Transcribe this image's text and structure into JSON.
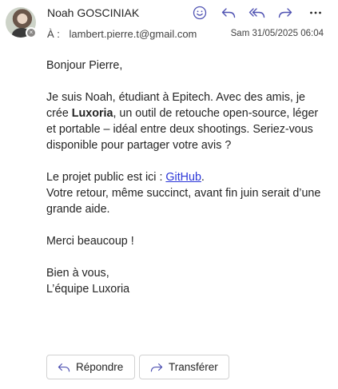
{
  "message": {
    "sender_name": "Noah GOSCINIAK",
    "to_label": "À :",
    "to_address": "lambert.pierre.t@gmail.com",
    "date": "Sam 31/05/2025 06:04",
    "presence_glyph": "×"
  },
  "toolbar": {
    "icons": [
      "emoji-icon",
      "reply-icon",
      "reply-all-icon",
      "forward-icon",
      "more-icon"
    ],
    "accent_color": "#4f52b2"
  },
  "body": {
    "greeting": "Bonjour Pierre,",
    "p1_start": "Je suis Noah, étudiant à Epitech. Avec des amis, je crée ",
    "p1_bold": "Luxoria",
    "p1_end": ", un outil de retouche open-source, léger et portable – idéal entre deux shootings. Seriez-vous disponible pour partager votre avis ?",
    "p2_start": "Le projet public est ici : ",
    "p2_link": "GitHub",
    "p2_end": ".",
    "p2_line2": "Votre retour, même succinct, avant fin juin serait d’une grande aide.",
    "thanks": "Merci beaucoup !",
    "closing": "Bien à vous,",
    "signature": "L’équipe Luxoria",
    "link_color": "#2b36d8"
  },
  "actions": {
    "reply_label": "Répondre",
    "forward_label": "Transférer"
  }
}
